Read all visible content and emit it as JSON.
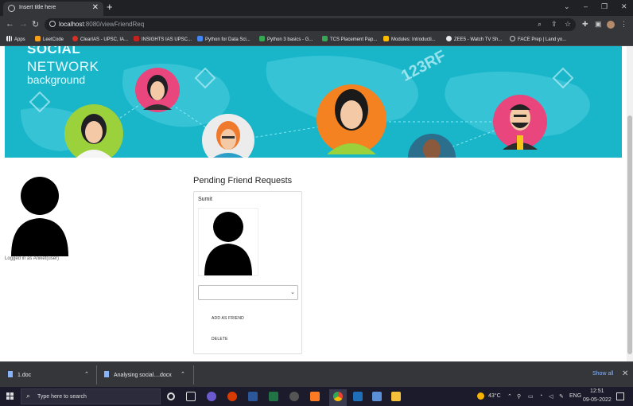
{
  "browser": {
    "tab_title": "Insert title here",
    "tab_close": "✕",
    "new_tab": "+",
    "window_controls": [
      "⌄",
      "–",
      "❐",
      "✕"
    ],
    "url_host": "localhost",
    "url_path": ":8080/viewFriendReq",
    "bookmarks": [
      {
        "label": "Apps",
        "color": "#e8eaed"
      },
      {
        "label": "LeetCode",
        "color": "#f89f1b"
      },
      {
        "label": "ClearIAS - UPSC, IA...",
        "color": "#d93025"
      },
      {
        "label": "INSIGHTS IAS UPSC...",
        "color": "#c5221f"
      },
      {
        "label": "Python for Data Sci...",
        "color": "#4285f4"
      },
      {
        "label": "Python 3 basics - G...",
        "color": "#34a853"
      },
      {
        "label": "TCS Placement Pap...",
        "color": "#34a853"
      },
      {
        "label": "Modules: Introducti...",
        "color": "#fbbc04"
      },
      {
        "label": "ZEE5 - Watch TV Sh...",
        "color": "#e8eaed"
      },
      {
        "label": "FACE Prep | Land yo...",
        "color": "#c8c8c8"
      }
    ]
  },
  "page": {
    "banner_line1": "SOCIAL",
    "banner_line2": "NETWORK",
    "banner_line3": "background",
    "watermark": "123RF",
    "login_status": "Logged in as Aniket(user)",
    "heading": "Pending Friend Requests",
    "request": {
      "name": "Sumit",
      "select_value": "",
      "add_label": "ADD AS FRIEND",
      "delete_label": "DELETE"
    }
  },
  "downloads": {
    "items": [
      {
        "name": "1.doc"
      },
      {
        "name": "Analysing social....docx"
      }
    ],
    "show_all": "Show all"
  },
  "taskbar": {
    "search_placeholder": "Type here to search",
    "weather": "43°C",
    "language": "ENG",
    "time": "12:51",
    "date": "09-05-2022"
  }
}
